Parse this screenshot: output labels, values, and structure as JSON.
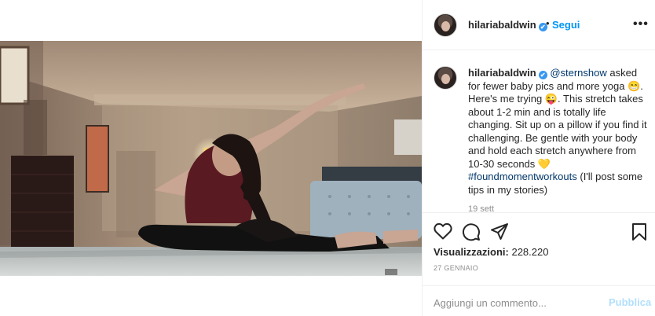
{
  "post": {
    "username": "hilariabaldwin",
    "verified_mark": "✔",
    "separator": "•",
    "follow_label": "Segui",
    "more_label": "•••"
  },
  "caption": {
    "username": "hilariabaldwin",
    "mention": "@sternshow",
    "text_part1": " asked for fewer baby pics and more yoga 😁. Here's me trying 😜. This stretch takes about 1-2 min and is totally life changing. Sit up on a pillow if you find it challenging. Be gentle with your body and hold each stretch anywhere from 10-30 seconds 💛 ",
    "hashtag": "#foundmomentworkouts",
    "text_part2": " (I'll post some tips in my stories)",
    "time": "19 sett"
  },
  "stats": {
    "views_label": "Visualizzazioni:",
    "views_value": "228.220",
    "date": "27 GENNAIO"
  },
  "comment": {
    "placeholder": "Aggiungi un commento...",
    "publish_label": "Pubblica"
  },
  "icons": {
    "like": "heart-icon",
    "comment": "comment-icon",
    "share": "share-icon",
    "save": "bookmark-icon"
  },
  "colors": {
    "link": "#0095f6",
    "verified": "#3897f0",
    "publish_disabled": "#b2dffc",
    "border": "#efefef"
  }
}
